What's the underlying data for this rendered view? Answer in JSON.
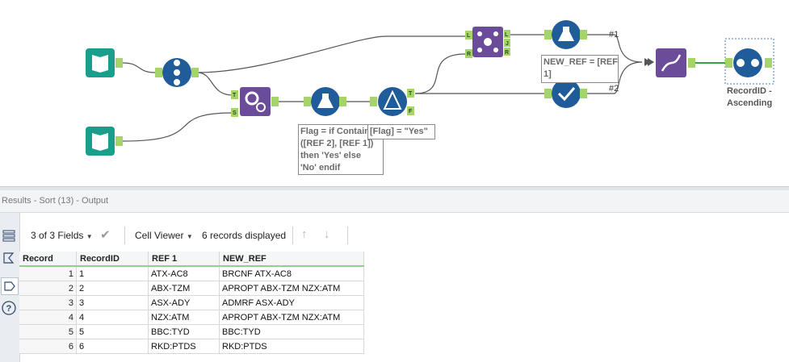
{
  "annotations": {
    "formula1": "Flag = if Contains\n([REF 2], [REF 1])\nthen 'Yes' else\n'No' endif",
    "filter": "[Flag] = \"Yes\"",
    "formula2": "NEW_REF = [REF\n1]",
    "sort": "RecordID -\nAscending"
  },
  "anchors": {
    "T": "T",
    "S": "S",
    "F": "F",
    "L": "L",
    "R": "R",
    "J": "J"
  },
  "conn_labels": {
    "c1": "#1",
    "c2": "#2"
  },
  "results": {
    "title": "Results - Sort (13) - Output",
    "fields_selector": "3 of 3 Fields",
    "viewer": "Cell Viewer",
    "records_displayed": "6 records displayed"
  },
  "table": {
    "headers": [
      "Record",
      "RecordID",
      "REF 1",
      "NEW_REF"
    ],
    "rows": [
      [
        "1",
        "1",
        "ATX-AC8",
        "BRCNF ATX-AC8"
      ],
      [
        "2",
        "2",
        "ABX-TZM",
        "APROPT ABX-TZM NZX:ATM"
      ],
      [
        "3",
        "3",
        "ASX-ADY",
        "ADMRF ASX-ADY"
      ],
      [
        "4",
        "4",
        "NZX:ATM",
        "APROPT ABX-TZM NZX:ATM"
      ],
      [
        "5",
        "5",
        "BBC:TYD",
        "BBC:TYD"
      ],
      [
        "6",
        "6",
        "RKD:PTDS",
        "RKD:PTDS"
      ]
    ]
  },
  "colors": {
    "input_tool": "#1a9e8c",
    "blue_tool": "#1f5c99",
    "purple_tool": "#6b4c9a",
    "anchor": "#a5d46a",
    "connection": "#555555",
    "active_connection": "#35a24a"
  }
}
